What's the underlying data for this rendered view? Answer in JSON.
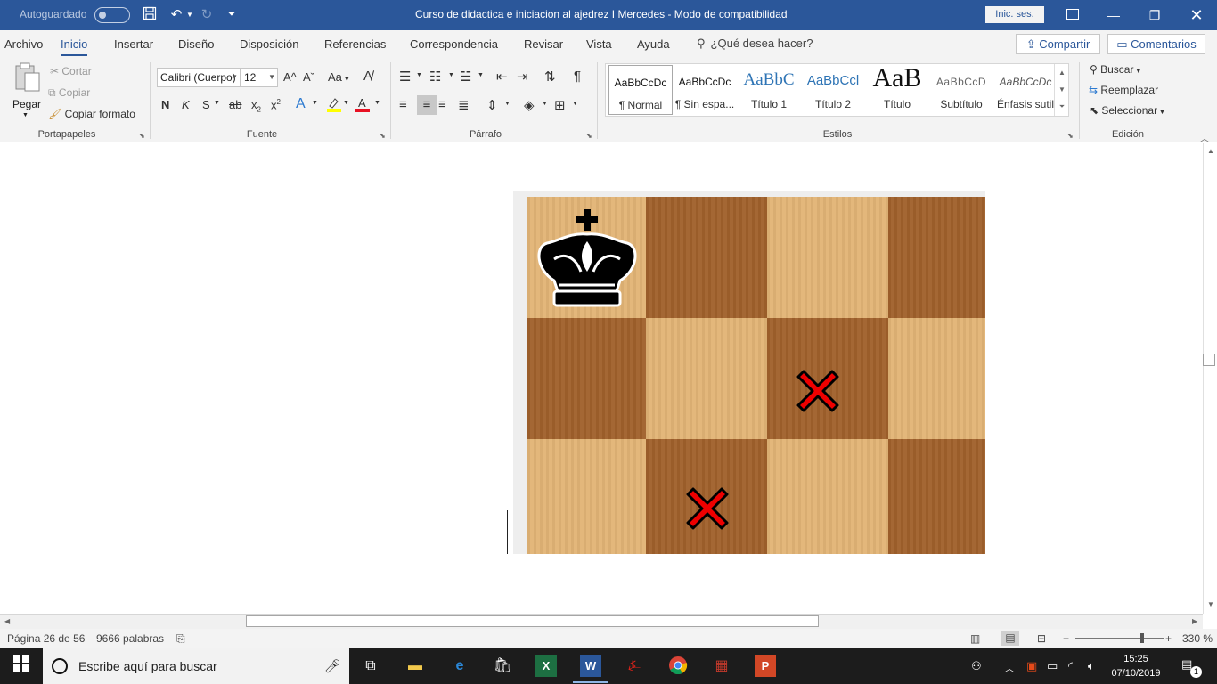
{
  "titlebar": {
    "autosave_label": "Autoguardado",
    "document_title": "Curso de didactica e iniciacion al ajedrez I Mercedes  -  Modo de compatibilidad",
    "signin_label": "Inic. ses."
  },
  "menu": {
    "tabs": [
      "Archivo",
      "Inicio",
      "Insertar",
      "Diseño",
      "Disposición",
      "Referencias",
      "Correspondencia",
      "Revisar",
      "Vista",
      "Ayuda"
    ],
    "active_tab": "Inicio",
    "tell_me": "¿Qué desea hacer?",
    "share_label": "Compartir",
    "comments_label": "Comentarios"
  },
  "ribbon": {
    "clipboard": {
      "paste_label": "Pegar",
      "cut_label": "Cortar",
      "copy_label": "Copiar",
      "format_painter_label": "Copiar formato",
      "group_label": "Portapapeles"
    },
    "font": {
      "font_name": "Calibri (Cuerpo)",
      "font_size": "12",
      "group_label": "Fuente",
      "bold_label": "N",
      "italic_label": "K",
      "underline_label": "S",
      "strike_label": "ab",
      "change_case_label": "Aa",
      "grow_label": "A^",
      "shrink_label": "Aˇ",
      "font_color": "#e81123",
      "highlight_color": "#ffff00"
    },
    "paragraph": {
      "group_label": "Párrafo",
      "pilcrow": "¶"
    },
    "styles": {
      "group_label": "Estilos",
      "items": [
        {
          "preview": "AaBbCcDc",
          "name": "¶ Normal"
        },
        {
          "preview": "AaBbCcDc",
          "name": "¶ Sin espa..."
        },
        {
          "preview": "AaBbC",
          "name": "Título 1"
        },
        {
          "preview": "AaBbCcl",
          "name": "Título 2"
        },
        {
          "preview": "AaB",
          "name": "Título"
        },
        {
          "preview": "AaBbCcD",
          "name": "Subtítulo"
        },
        {
          "preview": "AaBbCcDc",
          "name": "Énfasis sutil"
        }
      ]
    },
    "editing": {
      "group_label": "Edición",
      "find_label": "Buscar",
      "replace_label": "Reemplazar",
      "select_label": "Seleccionar"
    }
  },
  "document": {
    "board_light": "#e2b476",
    "board_dark": "#a0612c",
    "king_symbol": "♚",
    "marker_symbol": "✖",
    "marker_color": "#ee0000"
  },
  "statusbar": {
    "page": "Página 26 de 56",
    "words": "9666 palabras",
    "zoom": "330 %"
  },
  "taskbar": {
    "search_placeholder": "Escribe aquí para buscar",
    "time": "15:25",
    "date": "07/10/2019",
    "notifications": "1"
  }
}
